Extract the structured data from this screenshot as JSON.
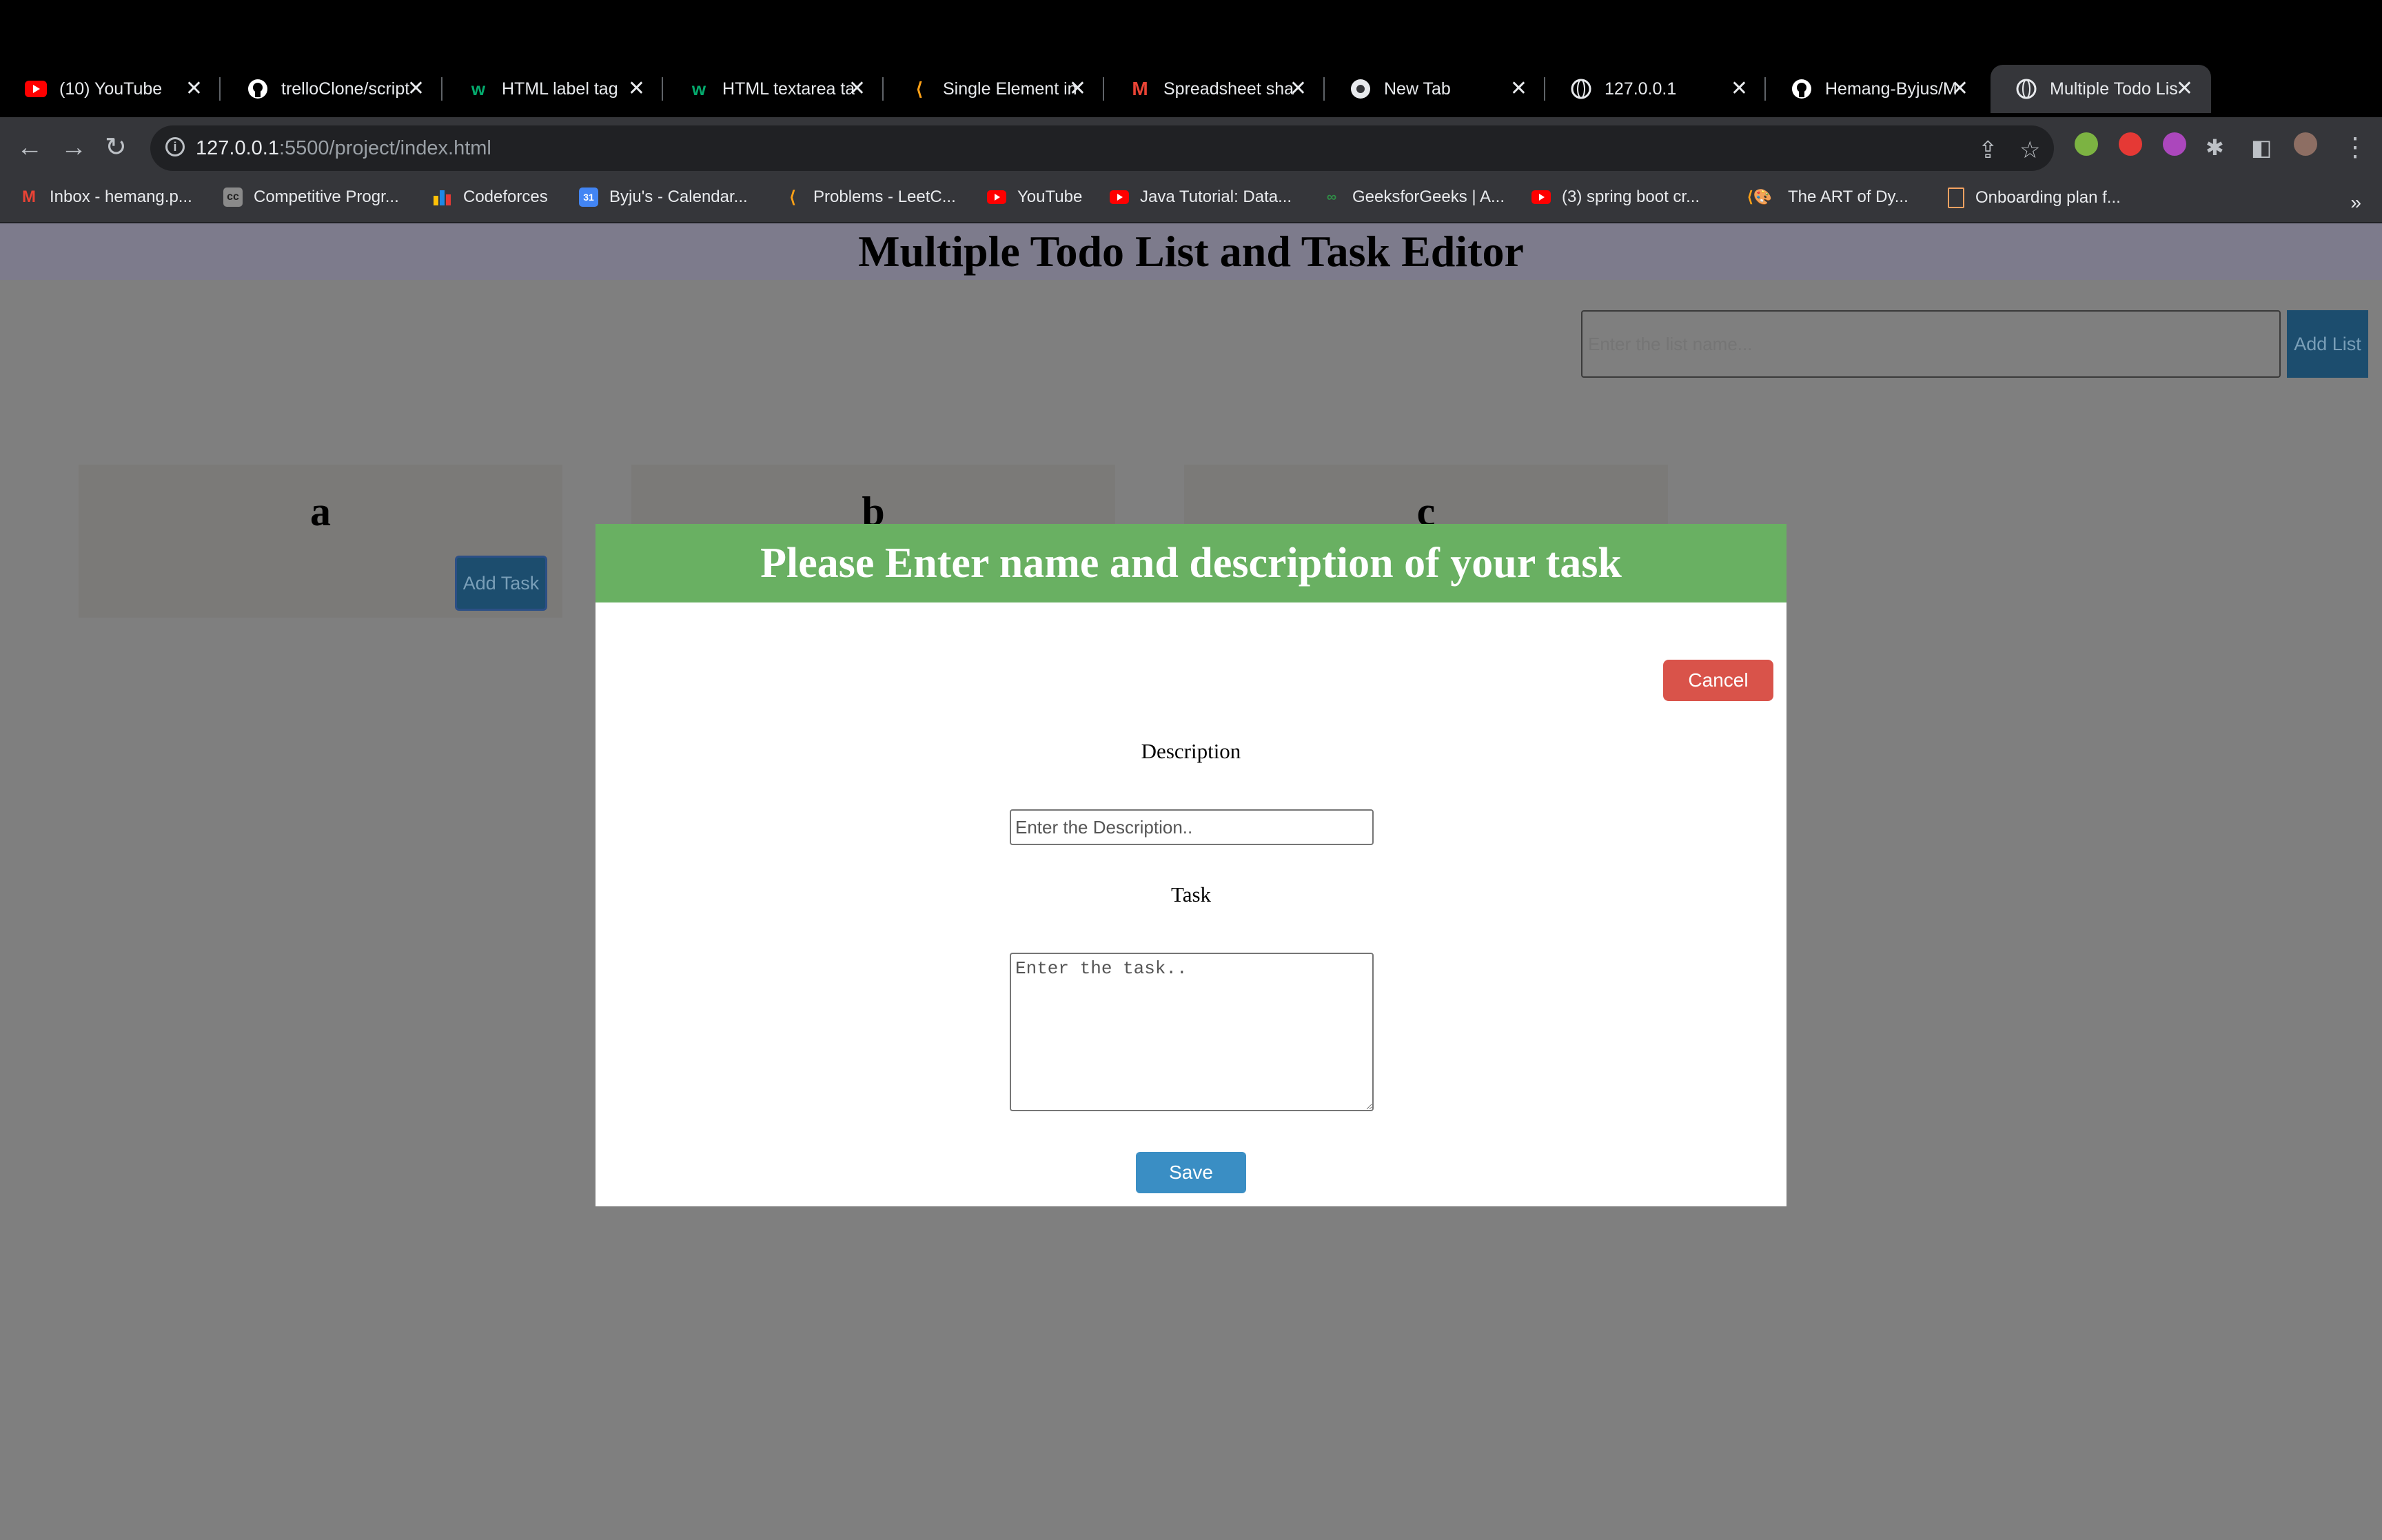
{
  "browser": {
    "tabs": [
      {
        "title": "(10) YouTube",
        "icon": "youtube-icon"
      },
      {
        "title": "trelloClone/script",
        "icon": "github-icon"
      },
      {
        "title": "HTML label tag",
        "icon": "w3schools-icon"
      },
      {
        "title": "HTML textarea ta",
        "icon": "w3schools-icon"
      },
      {
        "title": "Single Element in",
        "icon": "leetcode-icon"
      },
      {
        "title": "Spreadsheet sha",
        "icon": "gmail-icon"
      },
      {
        "title": "New Tab",
        "icon": "chrome-icon"
      },
      {
        "title": "127.0.0.1",
        "icon": "globe-icon"
      },
      {
        "title": "Hemang-Byjus/M",
        "icon": "github-icon"
      },
      {
        "title": "Multiple Todo Lis",
        "icon": "globe-icon",
        "active": true
      }
    ],
    "url_host": "127.0.0.1",
    "url_path": ":5500/project/index.html",
    "bookmarks": [
      {
        "label": "Inbox - hemang.p...",
        "icon": "gmail-icon"
      },
      {
        "label": "Competitive Progr...",
        "icon": "cc-icon"
      },
      {
        "label": "Codeforces",
        "icon": "codeforces-icon"
      },
      {
        "label": "Byju's - Calendar...",
        "icon": "calendar-icon"
      },
      {
        "label": "Problems - LeetC...",
        "icon": "leetcode-icon"
      },
      {
        "label": "YouTube",
        "icon": "youtube-icon"
      },
      {
        "label": "Java Tutorial: Data...",
        "icon": "youtube-icon"
      },
      {
        "label": "GeeksforGeeks | A...",
        "icon": "gfg-icon"
      },
      {
        "label": "(3) spring boot cr...",
        "icon": "youtube-icon"
      },
      {
        "label": "The ART of Dy...",
        "icon": "leetcode-icon"
      },
      {
        "label": "Onboarding plan f...",
        "icon": "doc-icon"
      }
    ],
    "bookmarks_more": "»"
  },
  "page": {
    "title": "Multiple Todo List and Task Editor",
    "list_input_placeholder": "Enter the list name...",
    "add_list_label": "Add List",
    "lists": [
      {
        "name": "a",
        "add_task_label": "Add Task"
      },
      {
        "name": "b"
      },
      {
        "name": "c"
      }
    ]
  },
  "modal": {
    "header": "Please Enter name and description of your task",
    "cancel_label": "Cancel",
    "description_label": "Description",
    "description_placeholder": "Enter the Description..",
    "task_label": "Task",
    "task_placeholder": "Enter the task..",
    "save_label": "Save"
  },
  "colors": {
    "modal_header": "#69b062",
    "cancel": "#d9534a",
    "save": "#3a8ec4",
    "overlay": "#7f7f7f"
  }
}
